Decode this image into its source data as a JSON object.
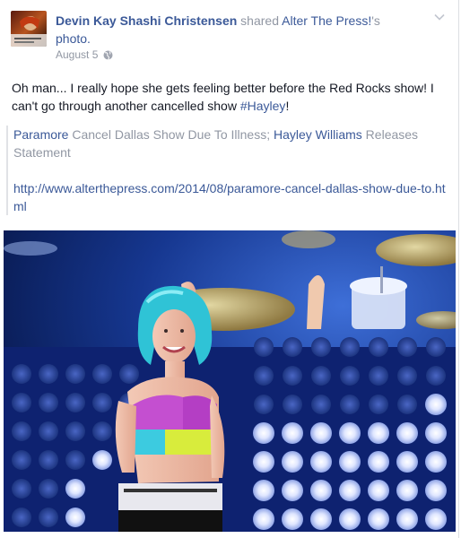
{
  "post": {
    "actor_name": "Devin Kay Shashi Christensen",
    "shared_text": " shared ",
    "page_name": "Alter The Press!",
    "possessive": "'s",
    "object_text": "photo.",
    "date": "August 5",
    "privacy_icon": "globe-icon",
    "options_icon": "chevron-down-icon",
    "message_part1": "Oh man... I really hope she gets feeling better before the Red Rocks show! I can't go through another cancelled show ",
    "hashtag": "#Hayley",
    "message_end": "!"
  },
  "shared": {
    "link1": "Paramore",
    "text1": " Cancel Dallas Show Due To Illness; ",
    "link2": "Hayley Williams",
    "text2": " Releases Statement",
    "url": "http://www.alterthepress.com/2014/08/paramore-cancel-dallas-show-due-to.html"
  },
  "colors": {
    "link": "#3b5998",
    "muted": "#9197a3",
    "text": "#141823",
    "stage_blue": "#1a3a9c",
    "hair": "#2fc3d6"
  }
}
